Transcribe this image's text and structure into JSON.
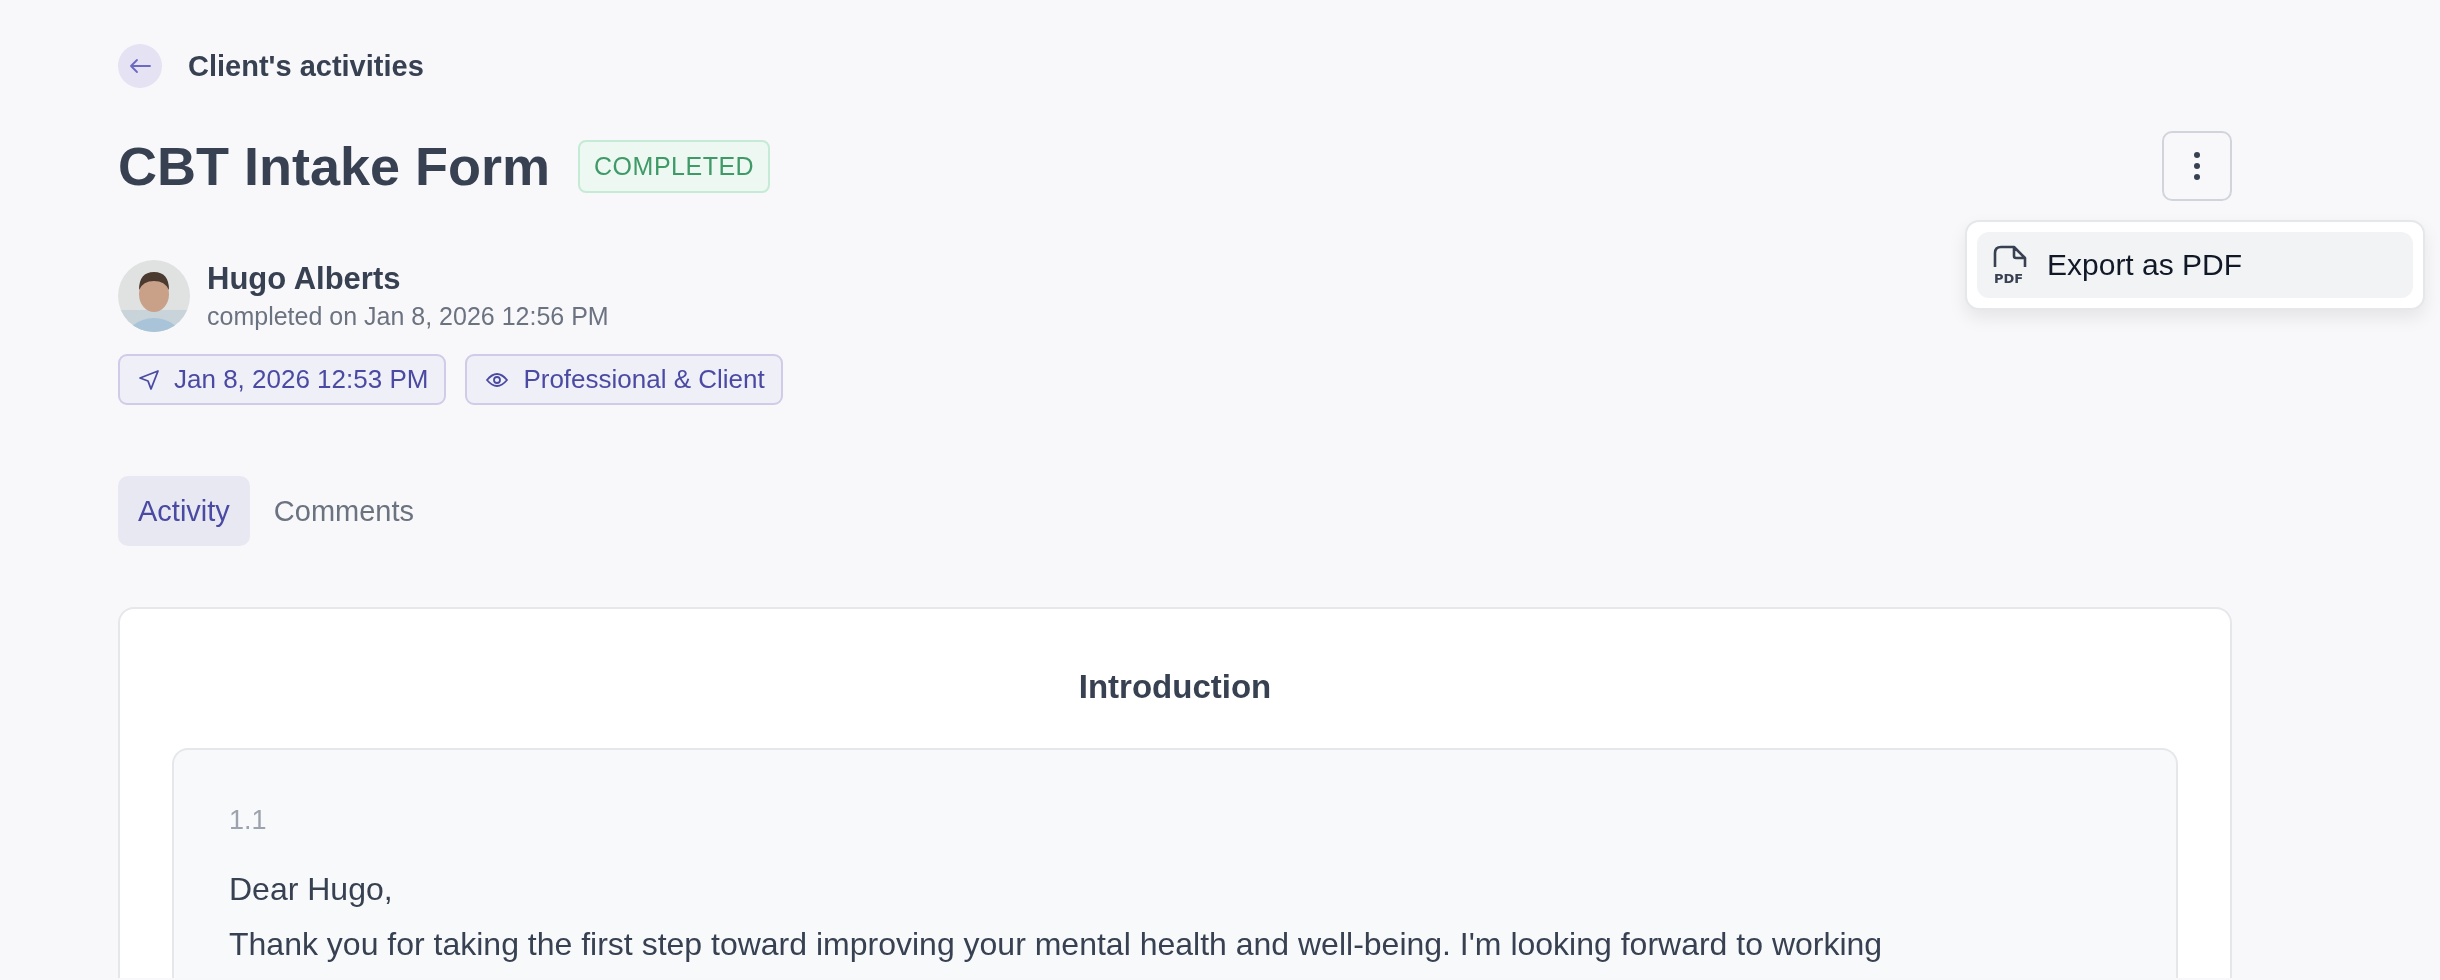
{
  "back_link": {
    "label": "Client's activities"
  },
  "title": "CBT Intake Form",
  "status_badge": "COMPLETED",
  "menu": {
    "items": [
      {
        "label": "Export as PDF",
        "icon_text": "PDF",
        "highlighted": true
      }
    ]
  },
  "author": {
    "name": "Hugo Alberts",
    "completed": "completed on Jan 8, 2026 12:56 PM"
  },
  "chips": [
    {
      "kind": "sent",
      "label": "Jan 8, 2026 12:53 PM"
    },
    {
      "kind": "visibility",
      "label": "Professional & Client"
    }
  ],
  "tabs": [
    {
      "label": "Activity",
      "selected": true
    },
    {
      "label": "Comments",
      "selected": false
    }
  ],
  "section": {
    "title": "Introduction",
    "questions": [
      {
        "number": "1.1",
        "paragraphs": [
          "Dear Hugo,",
          "Thank you for taking the first step toward improving your mental health and well-being. I'm looking forward to working"
        ]
      }
    ]
  }
}
